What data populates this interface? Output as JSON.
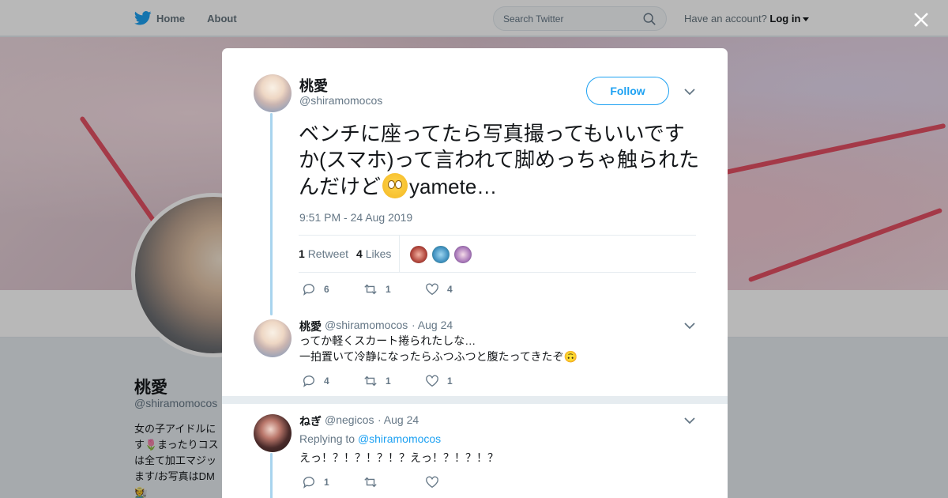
{
  "topbar": {
    "home_label": "Home",
    "about_label": "About",
    "search_placeholder": "Search Twitter",
    "account_prompt": "Have an account?",
    "login_label": "Log in"
  },
  "profile": {
    "name": "桃愛",
    "handle": "@shiramomocos",
    "bio_lines": [
      "女の子アイドルに",
      "す🌷まったりコス",
      "は全て加工マジッ",
      "ます/お写真はDM",
      "🧑‍🌾"
    ]
  },
  "tweet": {
    "author_name": "桃愛",
    "author_handle": "@shiramomocos",
    "follow_label": "Follow",
    "text_before_emoji": "ベンチに座ってたら写真撮ってもいいですか(スマホ)って言われて脚めっちゃ触られたんだけど",
    "text_after_emoji": "yamete…",
    "timestamp": "9:51 PM - 24 Aug 2019",
    "retweets_count": "1",
    "retweets_label": "Retweet",
    "likes_count": "4",
    "likes_label": "Likes",
    "actions": {
      "reply": "6",
      "retweet": "1",
      "like": "4"
    }
  },
  "reply1": {
    "author_name": "桃愛",
    "author_handle": "@shiramomocos",
    "date": "· Aug 24",
    "line1": "ってか軽くスカート捲られたしな…",
    "line2": "一拍置いて冷静になったらふつふつと腹たってきたぞ🙃",
    "actions": {
      "reply": "4",
      "retweet": "1",
      "like": "1"
    }
  },
  "reply2": {
    "author_name": "ねぎ",
    "author_handle": "@negicos",
    "date": "· Aug 24",
    "replying_prefix": "Replying to",
    "replying_to": "@shiramomocos",
    "text": "えっ！？！？！？！？えっ！？！？！？",
    "actions": {
      "reply": "1",
      "retweet": "",
      "like": ""
    }
  },
  "colors": {
    "accent": "#1da1f2",
    "thread_line": "#a8d4ee",
    "ribbon": "#e23a4f"
  },
  "icons": [
    "twitter-bird-icon",
    "search-icon",
    "close-icon",
    "chevron-down-icon",
    "reply-icon",
    "retweet-icon",
    "heart-icon"
  ]
}
